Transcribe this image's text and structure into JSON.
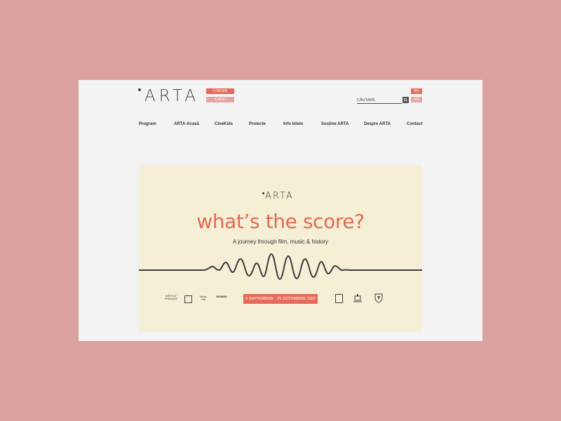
{
  "header": {
    "logo_text": "ARTA",
    "subtabs": [
      "CINEMA",
      "CAFE"
    ],
    "search_placeholder": "CĂUTARE",
    "languages": [
      "RO",
      "EN"
    ]
  },
  "nav": {
    "items": [
      "Program",
      "ARTA-Acasă",
      "CineKids",
      "Proiecte",
      "Info bilete",
      "Susține ARTA",
      "Despre ARTA",
      "Contact"
    ]
  },
  "banner": {
    "logo_text": "ARTA",
    "title": "what’s the score?",
    "subtitle": "A journey through film, music & history",
    "dates": "6 SEPTEMBRIE - 25 OCTOMBRIE 2022",
    "partner_logos_left": [
      "INSTITUT FRANÇAIS",
      "Music Hall",
      "MINIMAN"
    ],
    "colors": {
      "accent": "#e06b56",
      "background": "#f4efd5"
    }
  },
  "colors": {
    "page_bg": "#dba19f",
    "site_bg": "#f3f3f3",
    "accent": "#e46b5b",
    "accent_light": "#e6a6a0"
  }
}
